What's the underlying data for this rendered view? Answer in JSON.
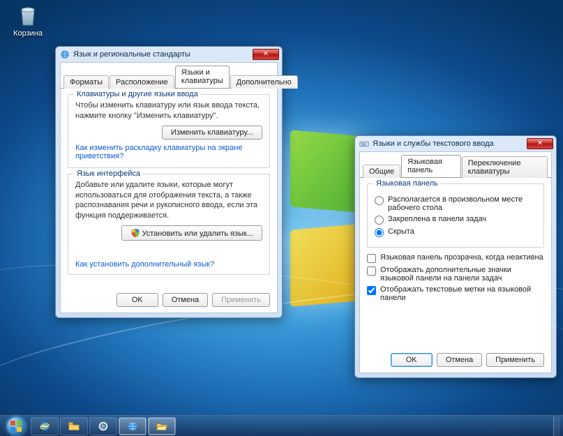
{
  "desktop": {
    "recycle_bin_label": "Корзина"
  },
  "win1": {
    "title": "Язык и региональные стандарты",
    "tabs": {
      "formats": "Форматы",
      "location": "Расположение",
      "keyboards": "Языки и клавиатуры",
      "advanced": "Дополнительно"
    },
    "group_keyboards_title": "Клавиатуры и другие языки ввода",
    "group_keyboards_desc": "Чтобы изменить клавиатуру или язык ввода текста, нажмите кнопку \"Изменить клавиатуру\".",
    "btn_change_keyboard": "Изменить клавиатуру...",
    "link_welcome_layout": "Как изменить раскладку клавиатуры на экране приветствия?",
    "group_uilang_title": "Язык интерфейса",
    "group_uilang_desc": "Добавьте или удалите языки, которые могут использоваться для отображения текста, а также распознавания речи и рукописного ввода, если эта функция поддерживается.",
    "btn_install_uninstall": "Установить или удалить язык...",
    "link_additional_lang": "Как установить дополнительный язык?",
    "btn_ok": "OK",
    "btn_cancel": "Отмена",
    "btn_apply": "Применить"
  },
  "win2": {
    "title": "Языки и службы текстового ввода",
    "tabs": {
      "general": "Общие",
      "langbar": "Языковая панель",
      "switching": "Переключение клавиатуры"
    },
    "group_langbar_title": "Языковая панель",
    "radio_float": "Располагается в произвольном месте рабочего стола",
    "radio_docked": "Закреплена в панели задач",
    "radio_hidden": "Скрыта",
    "chk_transparent": "Языковая панель прозрачна, когда неактивна",
    "chk_extra_icons": "Отображать дополнительные значки языковой панели на панели задач",
    "chk_text_labels": "Отображать текстовые метки на языковой панели",
    "btn_ok": "OK",
    "btn_cancel": "Отмена",
    "btn_apply": "Применить"
  },
  "taskbar": {
    "items": [
      "start",
      "ie",
      "explorer",
      "wmp",
      "control-panel",
      "folder-open"
    ]
  }
}
